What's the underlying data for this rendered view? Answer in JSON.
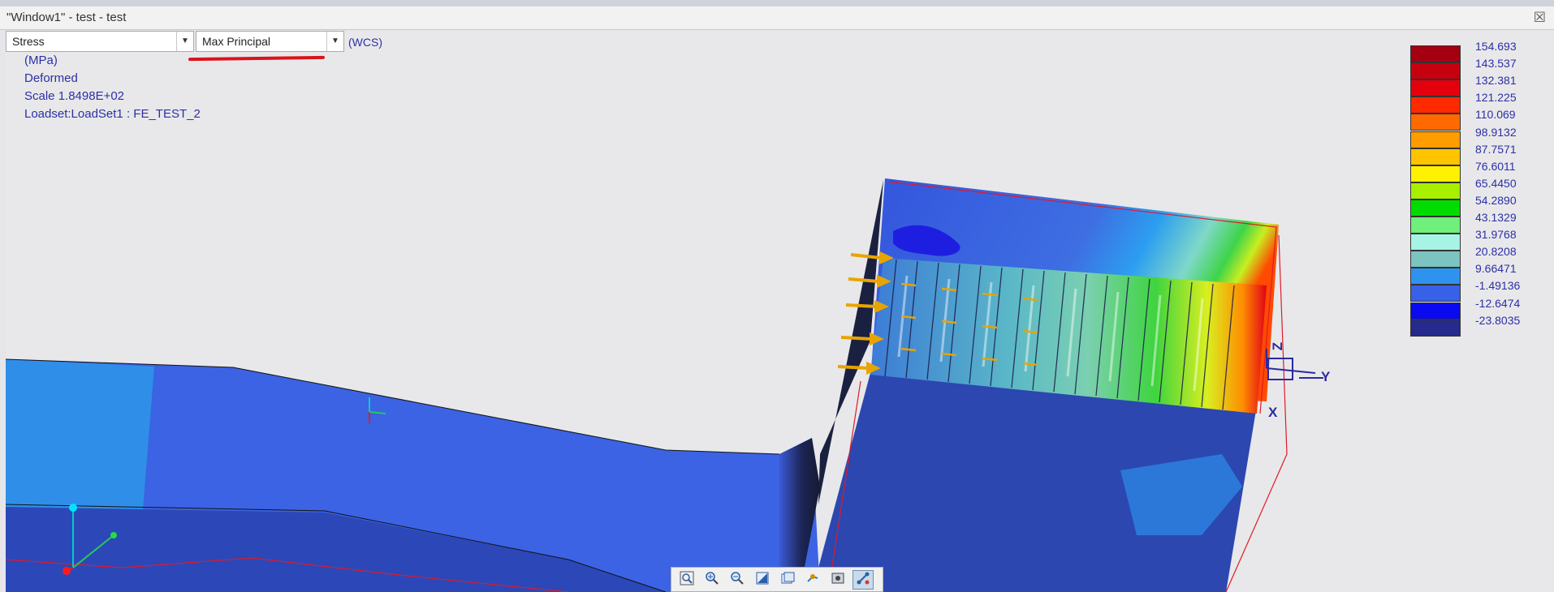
{
  "window": {
    "title": "\"Window1\" - test - test",
    "close_glyph": "☒"
  },
  "result_type": {
    "value": "Stress"
  },
  "component": {
    "value": "Max Principal"
  },
  "coord_system": "(WCS)",
  "info": {
    "units": "(MPa)",
    "display": "Deformed",
    "scale": "Scale  1.8498E+02",
    "loadset": "Loadset:LoadSet1 :  FE_TEST_2"
  },
  "legend": {
    "values": [
      "154.693",
      "143.537",
      "132.381",
      "121.225",
      "110.069",
      "98.9132",
      "87.7571",
      "76.6011",
      "65.4450",
      "54.2890",
      "43.1329",
      "31.9768",
      "20.8208",
      "9.66471",
      "-1.49136",
      "-12.6474",
      "-23.8035"
    ],
    "colors": [
      "#a40012",
      "#c6000f",
      "#e3000c",
      "#ff2a00",
      "#ff6a00",
      "#ff9c00",
      "#ffc400",
      "#fff200",
      "#a8f000",
      "#00dc00",
      "#6ff07a",
      "#a7f4e6",
      "#7cc4c0",
      "#2e93ee",
      "#3761e6",
      "#0a0af0",
      "#252a8c"
    ]
  },
  "triad": {
    "z": "Z",
    "y": "Y",
    "x": "X"
  },
  "toolbar": {
    "icons": [
      "zoom-fit-icon",
      "zoom-in-icon",
      "zoom-out-icon",
      "refit-icon",
      "view-orient-icon",
      "spin-center-icon",
      "display-style-icon",
      "datum-display-icon"
    ],
    "active_index": 7
  }
}
